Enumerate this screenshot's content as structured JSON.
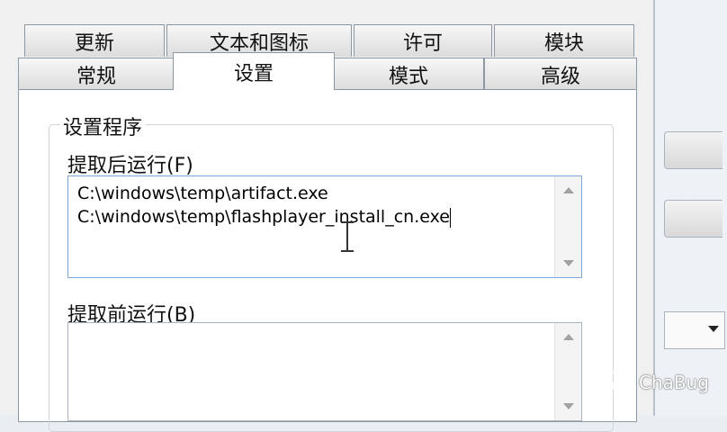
{
  "tabs_row1": [
    "更新",
    "文本和图标",
    "许可",
    "模块"
  ],
  "tabs_row2": [
    "常规",
    "设置",
    "模式",
    "高级"
  ],
  "active_tab": "设置",
  "group": {
    "title": "设置程序",
    "run_after_label": "提取后运行(F)",
    "run_after_lines": [
      "C:\\windows\\temp\\artifact.exe",
      "C:\\windows\\temp\\flashplayer_install_cn.exe"
    ],
    "run_before_label": "提取前运行(B)",
    "run_before_lines": []
  },
  "watermark": {
    "text": "ChaBug",
    "icon": "wechat-icon"
  },
  "colors": {
    "dialog_bg": "#f0f0f0",
    "panel_bg": "#ffffff",
    "focus_border": "#7ea8d7"
  }
}
